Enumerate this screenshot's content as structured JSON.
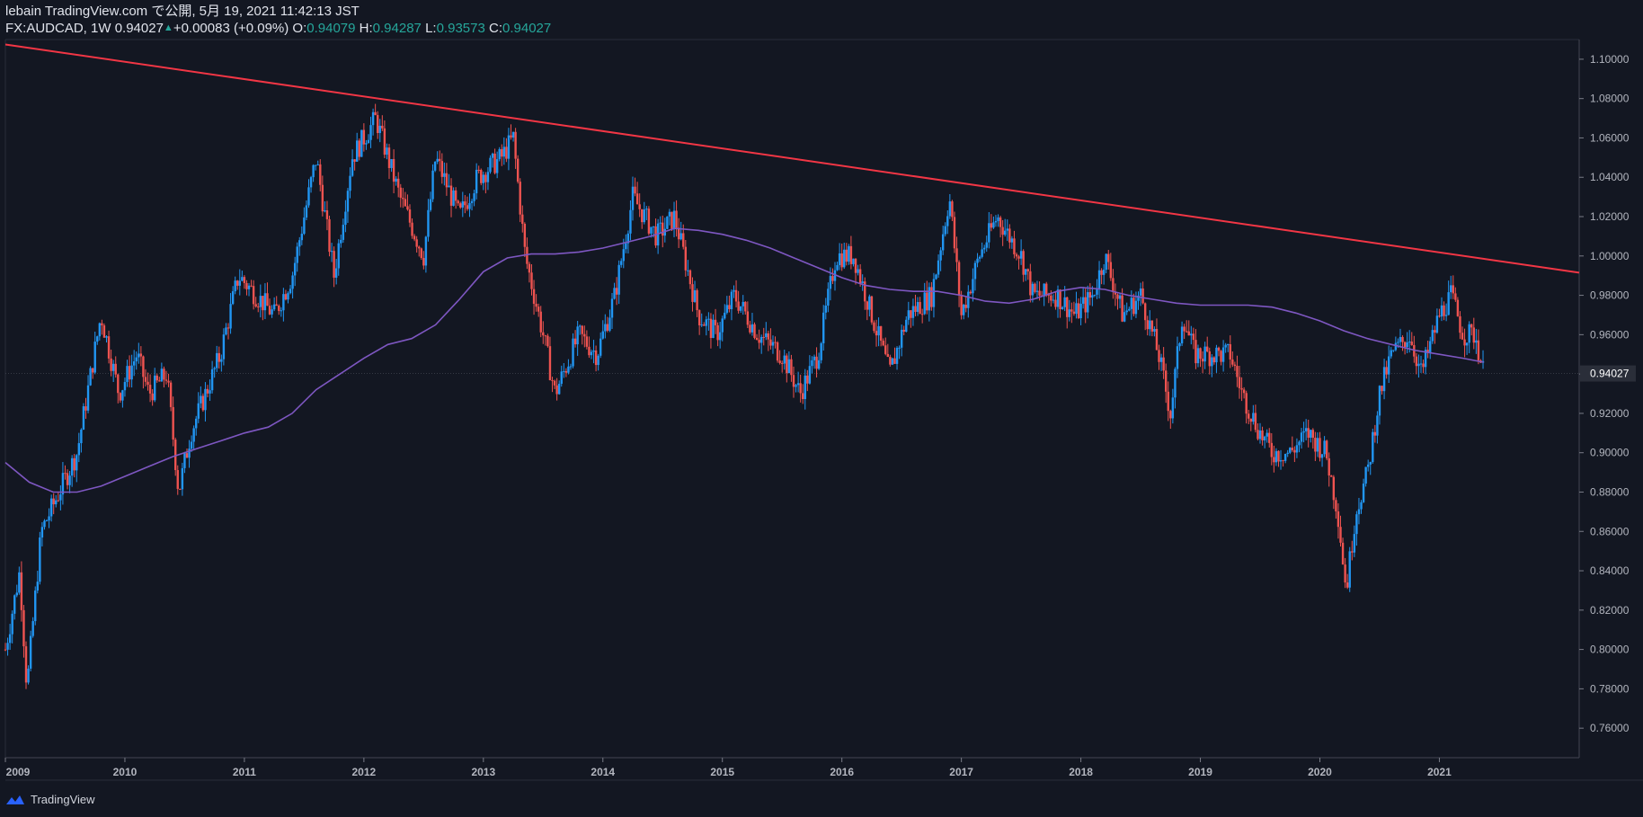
{
  "header": {
    "line1": "lebain TradingView.com で公開, 5月 19, 2021 11:42:13 JST",
    "symbol": "FX:AUDCAD, 1W",
    "last": "0.94027",
    "change": "+0.00083 (+0.09%)",
    "o_label": "O:",
    "o_val": "0.94079",
    "h_label": "H:",
    "h_val": "0.94287",
    "l_label": "L:",
    "l_val": "0.93573",
    "c_label": "C:",
    "c_val": "0.94027"
  },
  "footer": {
    "brand": "TradingView"
  },
  "colors": {
    "bg": "#131722",
    "up": "#2196f3",
    "down": "#ef5350",
    "trend": "#f23645",
    "ma": "#7e57c2",
    "text": "#b2b5be"
  },
  "chart_data": {
    "type": "candlestick",
    "symbol": "FX:AUDCAD",
    "interval": "1W",
    "ylim": [
      0.745,
      1.11
    ],
    "y_ticks": [
      1.1,
      1.08,
      1.06,
      1.04,
      1.02,
      1.0,
      0.98,
      0.96,
      0.94,
      0.92,
      0.9,
      0.88,
      0.86,
      0.84,
      0.82,
      0.8,
      0.78,
      0.76
    ],
    "y_tick_labels": [
      "1.10000",
      "1.08000",
      "1.06000",
      "1.04000",
      "1.02000",
      "1.00000",
      "0.98000",
      "0.96000",
      "0.94000",
      "0.92000",
      "0.90000",
      "0.88000",
      "0.86000",
      "0.84000",
      "0.82000",
      "0.80000",
      "0.78000",
      "0.76000"
    ],
    "x_labels": [
      "2009",
      "2010",
      "2011",
      "2012",
      "2013",
      "2014",
      "2015",
      "2016",
      "2017",
      "2018",
      "2019",
      "2020",
      "2021"
    ],
    "x_range": [
      2009.0,
      2022.17
    ],
    "last_price_label": "0.94027",
    "last_price": 0.94027,
    "price_path": [
      [
        2009.0,
        0.8
      ],
      [
        2009.12,
        0.84
      ],
      [
        2009.18,
        0.78
      ],
      [
        2009.3,
        0.86
      ],
      [
        2009.45,
        0.88
      ],
      [
        2009.6,
        0.9
      ],
      [
        2009.8,
        0.97
      ],
      [
        2009.95,
        0.93
      ],
      [
        2010.1,
        0.95
      ],
      [
        2010.2,
        0.93
      ],
      [
        2010.35,
        0.94
      ],
      [
        2010.45,
        0.88
      ],
      [
        2010.55,
        0.91
      ],
      [
        2010.8,
        0.95
      ],
      [
        2010.95,
        0.99
      ],
      [
        2011.1,
        0.98
      ],
      [
        2011.25,
        0.97
      ],
      [
        2011.4,
        0.99
      ],
      [
        2011.6,
        1.05
      ],
      [
        2011.75,
        0.99
      ],
      [
        2011.9,
        1.05
      ],
      [
        2012.1,
        1.07
      ],
      [
        2012.3,
        1.03
      ],
      [
        2012.5,
        1.0
      ],
      [
        2012.6,
        1.05
      ],
      [
        2012.8,
        1.02
      ],
      [
        2012.95,
        1.04
      ],
      [
        2013.15,
        1.05
      ],
      [
        2013.25,
        1.06
      ],
      [
        2013.35,
        1.0
      ],
      [
        2013.5,
        0.96
      ],
      [
        2013.6,
        0.93
      ],
      [
        2013.8,
        0.96
      ],
      [
        2013.95,
        0.95
      ],
      [
        2014.1,
        0.98
      ],
      [
        2014.25,
        1.03
      ],
      [
        2014.45,
        1.01
      ],
      [
        2014.6,
        1.02
      ],
      [
        2014.8,
        0.97
      ],
      [
        2014.95,
        0.96
      ],
      [
        2015.1,
        0.98
      ],
      [
        2015.3,
        0.96
      ],
      [
        2015.5,
        0.95
      ],
      [
        2015.65,
        0.93
      ],
      [
        2015.8,
        0.95
      ],
      [
        2015.95,
        1.0
      ],
      [
        2016.1,
        1.0
      ],
      [
        2016.3,
        0.96
      ],
      [
        2016.4,
        0.94
      ],
      [
        2016.55,
        0.97
      ],
      [
        2016.75,
        0.98
      ],
      [
        2016.9,
        1.03
      ],
      [
        2017.0,
        0.97
      ],
      [
        2017.15,
        1.0
      ],
      [
        2017.3,
        1.02
      ],
      [
        2017.5,
        1.0
      ],
      [
        2017.6,
        0.98
      ],
      [
        2017.8,
        0.98
      ],
      [
        2017.95,
        0.97
      ],
      [
        2018.1,
        0.98
      ],
      [
        2018.2,
        1.0
      ],
      [
        2018.35,
        0.97
      ],
      [
        2018.5,
        0.98
      ],
      [
        2018.65,
        0.95
      ],
      [
        2018.75,
        0.92
      ],
      [
        2018.85,
        0.97
      ],
      [
        2018.95,
        0.95
      ],
      [
        2019.1,
        0.95
      ],
      [
        2019.25,
        0.95
      ],
      [
        2019.35,
        0.93
      ],
      [
        2019.5,
        0.91
      ],
      [
        2019.6,
        0.9
      ],
      [
        2019.75,
        0.9
      ],
      [
        2019.9,
        0.91
      ],
      [
        2020.05,
        0.9
      ],
      [
        2020.15,
        0.87
      ],
      [
        2020.22,
        0.83
      ],
      [
        2020.3,
        0.87
      ],
      [
        2020.4,
        0.89
      ],
      [
        2020.5,
        0.93
      ],
      [
        2020.6,
        0.95
      ],
      [
        2020.75,
        0.96
      ],
      [
        2020.85,
        0.94
      ],
      [
        2021.0,
        0.97
      ],
      [
        2021.1,
        0.98
      ],
      [
        2021.2,
        0.96
      ],
      [
        2021.3,
        0.96
      ],
      [
        2021.37,
        0.94027
      ]
    ],
    "trend_line": {
      "x": [
        2009.0,
        2022.17
      ],
      "y": [
        1.1075,
        0.9915
      ]
    },
    "moving_average": [
      [
        2009.0,
        0.895
      ],
      [
        2009.2,
        0.885
      ],
      [
        2009.4,
        0.88
      ],
      [
        2009.6,
        0.88
      ],
      [
        2009.8,
        0.883
      ],
      [
        2010.0,
        0.888
      ],
      [
        2010.2,
        0.893
      ],
      [
        2010.4,
        0.898
      ],
      [
        2010.6,
        0.902
      ],
      [
        2010.8,
        0.906
      ],
      [
        2011.0,
        0.91
      ],
      [
        2011.2,
        0.913
      ],
      [
        2011.4,
        0.92
      ],
      [
        2011.6,
        0.932
      ],
      [
        2011.8,
        0.94
      ],
      [
        2012.0,
        0.948
      ],
      [
        2012.2,
        0.955
      ],
      [
        2012.4,
        0.958
      ],
      [
        2012.6,
        0.965
      ],
      [
        2012.8,
        0.978
      ],
      [
        2013.0,
        0.992
      ],
      [
        2013.2,
        0.999
      ],
      [
        2013.4,
        1.001
      ],
      [
        2013.6,
        1.001
      ],
      [
        2013.8,
        1.002
      ],
      [
        2014.0,
        1.004
      ],
      [
        2014.2,
        1.007
      ],
      [
        2014.4,
        1.01
      ],
      [
        2014.6,
        1.014
      ],
      [
        2014.8,
        1.013
      ],
      [
        2015.0,
        1.011
      ],
      [
        2015.2,
        1.008
      ],
      [
        2015.4,
        1.004
      ],
      [
        2015.6,
        0.999
      ],
      [
        2015.8,
        0.994
      ],
      [
        2016.0,
        0.989
      ],
      [
        2016.2,
        0.985
      ],
      [
        2016.4,
        0.983
      ],
      [
        2016.6,
        0.982
      ],
      [
        2016.8,
        0.982
      ],
      [
        2017.0,
        0.98
      ],
      [
        2017.2,
        0.977
      ],
      [
        2017.4,
        0.976
      ],
      [
        2017.6,
        0.978
      ],
      [
        2017.8,
        0.982
      ],
      [
        2018.0,
        0.984
      ],
      [
        2018.2,
        0.983
      ],
      [
        2018.4,
        0.98
      ],
      [
        2018.6,
        0.978
      ],
      [
        2018.8,
        0.976
      ],
      [
        2019.0,
        0.975
      ],
      [
        2019.2,
        0.975
      ],
      [
        2019.4,
        0.975
      ],
      [
        2019.6,
        0.974
      ],
      [
        2019.8,
        0.971
      ],
      [
        2020.0,
        0.967
      ],
      [
        2020.2,
        0.962
      ],
      [
        2020.4,
        0.958
      ],
      [
        2020.6,
        0.955
      ],
      [
        2020.8,
        0.952
      ],
      [
        2021.0,
        0.95
      ],
      [
        2021.2,
        0.948
      ],
      [
        2021.37,
        0.946
      ]
    ]
  }
}
